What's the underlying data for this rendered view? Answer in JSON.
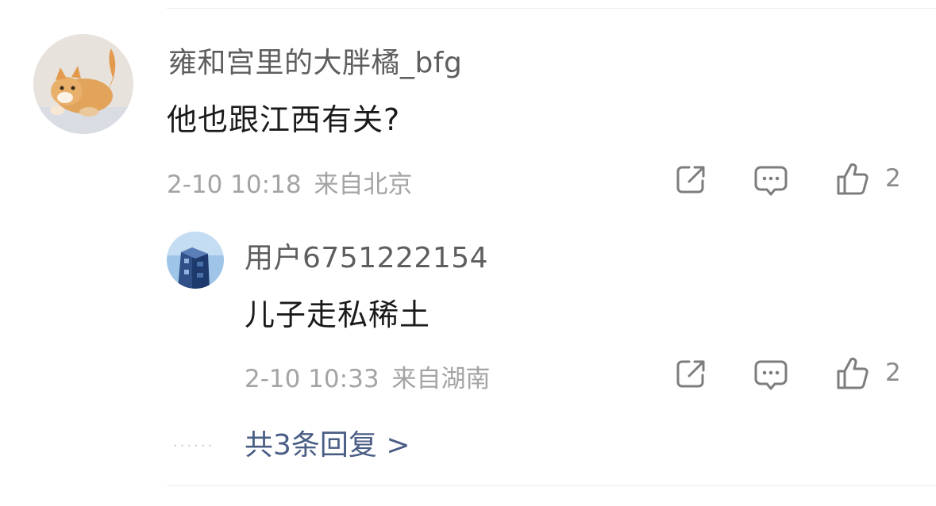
{
  "comment": {
    "username": "雍和宫里的大胖橘_bfg",
    "text": "他也跟江西有关?",
    "time": "2-10 10:18",
    "location": "来自北京",
    "like_count": "2"
  },
  "reply": {
    "username": "用户6751222154",
    "text": "儿子走私稀土",
    "time": "2-10 10:33",
    "location": "来自湖南",
    "like_count": "2"
  },
  "more_replies": {
    "dots": "······",
    "label": "共3条回复 >"
  },
  "icons": {
    "share": "share-icon",
    "comment": "comment-icon",
    "like": "thumbs-up-icon"
  },
  "colors": {
    "link": "#4a5e85",
    "meta": "#a4a4a4",
    "icon": "#7d7d7d"
  }
}
